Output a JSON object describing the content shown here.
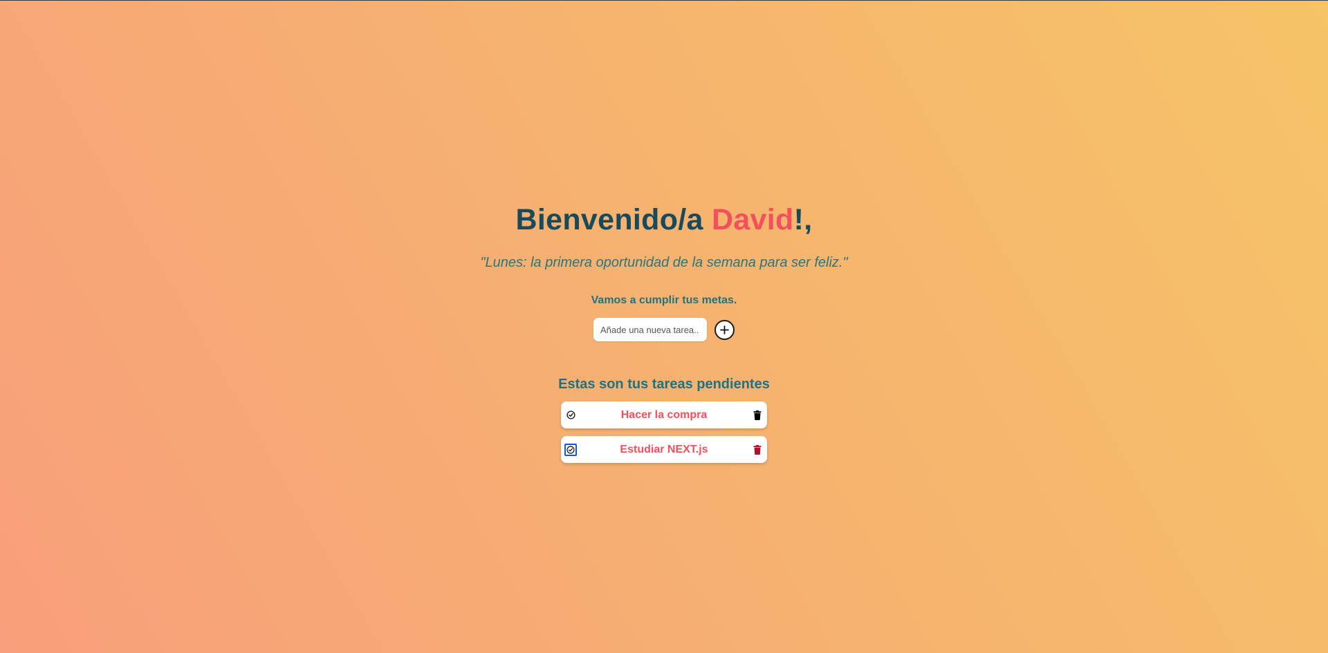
{
  "header": {
    "greeting": "Bienvenido/a ",
    "name": "David",
    "suffix": "!,"
  },
  "quote": "\"Lunes: la primera oportunidad de la semana para ser feliz.\"",
  "motto": "Vamos a cumplir tus metas.",
  "new_task": {
    "placeholder": "Añade una nueva tarea..",
    "value": "",
    "add_icon": "plus-icon"
  },
  "pending": {
    "title": "Estas son tus tareas pendientes",
    "tasks": [
      {
        "text": "Hacer la compra",
        "check_icon": "check-circle-icon",
        "delete_icon": "trash-icon",
        "delete_color": "#000000"
      },
      {
        "text": "Estudiar NEXT.js",
        "check_icon": "check-circle-icon",
        "delete_icon": "trash-icon",
        "delete_color": "#b0102a"
      }
    ]
  },
  "colors": {
    "primary_dark": "#174a5c",
    "teal": "#1f7380",
    "accent": "#f2505c",
    "background_start": "#f89f7b",
    "background_end": "#f6c367"
  }
}
